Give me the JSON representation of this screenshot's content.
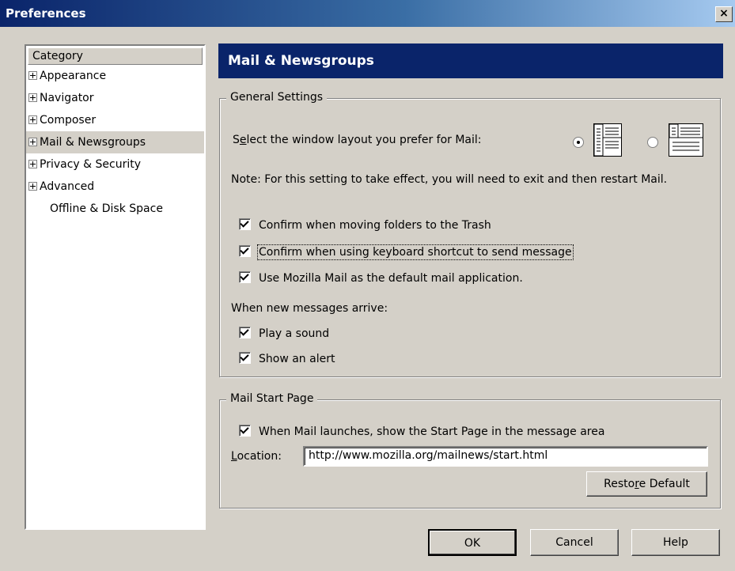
{
  "window": {
    "title": "Preferences",
    "close_glyph": "×"
  },
  "sidebar": {
    "header": "Category",
    "items": [
      {
        "label": "Appearance",
        "expandable": true,
        "selected": false
      },
      {
        "label": "Navigator",
        "expandable": true,
        "selected": false
      },
      {
        "label": "Composer",
        "expandable": true,
        "selected": false
      },
      {
        "label": "Mail & Newsgroups",
        "expandable": true,
        "selected": true
      },
      {
        "label": "Privacy & Security",
        "expandable": true,
        "selected": false
      },
      {
        "label": "Advanced",
        "expandable": true,
        "selected": false
      },
      {
        "label": "Offline & Disk Space",
        "expandable": false,
        "selected": false
      }
    ]
  },
  "panel": {
    "title": "Mail & Newsgroups",
    "general": {
      "title": "General Settings",
      "layout_label_pre": "S",
      "layout_label_accel": "e",
      "layout_label_post": "lect the window layout you prefer for Mail:",
      "layout_selected": "classic",
      "note": "Note: For this setting to take effect, you will need to exit and then restart Mail.",
      "checkboxes": [
        {
          "label": "Confirm when moving folders to the Trash",
          "checked": true
        },
        {
          "label": "Confirm when using keyboard shortcut to send message",
          "checked": true
        },
        {
          "label": "Use Mozilla Mail as the default mail application.",
          "checked": true
        }
      ],
      "new_messages_label": "When new messages arrive:",
      "new_message_checkboxes": [
        {
          "label": "Play a sound",
          "checked": true
        },
        {
          "label": "Show an alert",
          "checked": true
        }
      ]
    },
    "start_page": {
      "title": "Mail Start Page",
      "checkbox_label": "When Mail launches, show the Start Page in the message area",
      "checkbox_checked": true,
      "location_label_accel": "L",
      "location_label_rest": "ocation:",
      "location_value": "http://www.mozilla.org/mailnews/start.html",
      "restore_pre": "Resto",
      "restore_accel": "r",
      "restore_post": "e Default"
    }
  },
  "footer": {
    "ok": "OK",
    "cancel": "Cancel",
    "help": "Help"
  },
  "icons": {
    "expander": "plus-box-icon",
    "check": "check-icon",
    "radio": "radio-icon",
    "layout_classic": "layout-classic-icon",
    "layout_wide": "layout-wide-icon"
  },
  "colors": {
    "titlebar": "#0a246a",
    "panel_header": "#0a246a",
    "dialog_bg": "#d4d0c8"
  }
}
